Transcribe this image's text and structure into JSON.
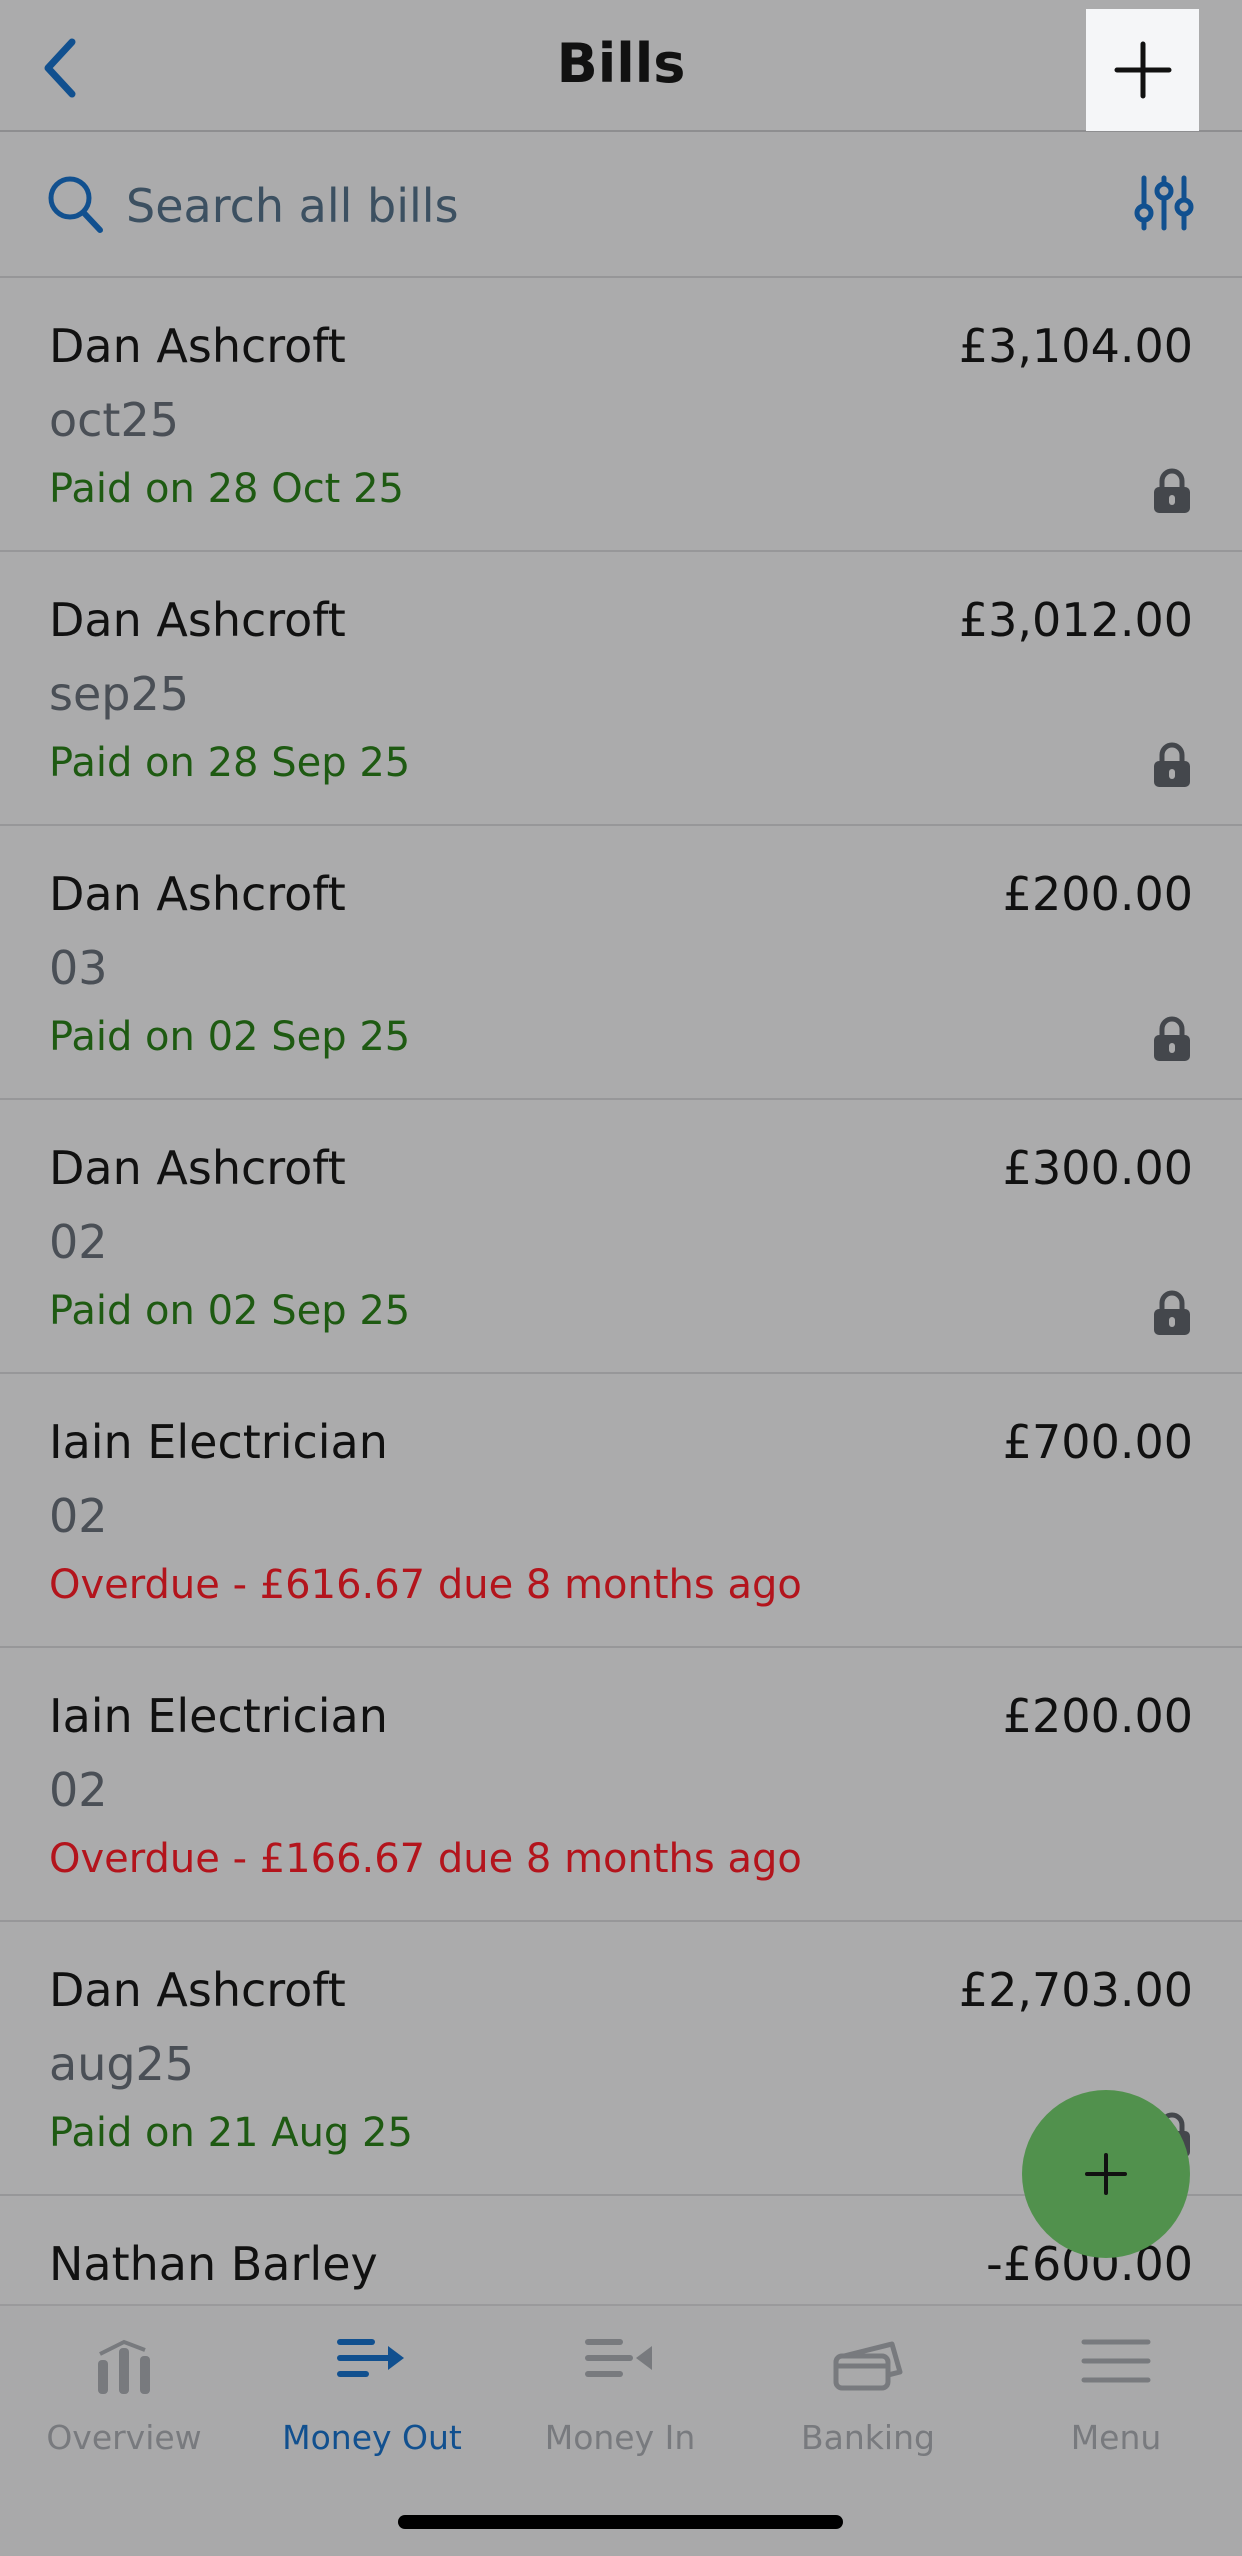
{
  "header": {
    "title": "Bills"
  },
  "search": {
    "placeholder": "Search all bills"
  },
  "colors": {
    "accent": "#11508f",
    "paid": "#1e5a12",
    "overdue": "#b3141c",
    "fab": "#51914d"
  },
  "bills": [
    {
      "name": "Dan Ashcroft",
      "amount": "£3,104.00",
      "reference": "oct25",
      "status": "Paid on 28 Oct 25",
      "status_type": "paid",
      "locked": true
    },
    {
      "name": "Dan Ashcroft",
      "amount": "£3,012.00",
      "reference": "sep25",
      "status": "Paid on 28 Sep 25",
      "status_type": "paid",
      "locked": true
    },
    {
      "name": "Dan Ashcroft",
      "amount": "£200.00",
      "reference": "03",
      "status": "Paid on 02 Sep 25",
      "status_type": "paid",
      "locked": true
    },
    {
      "name": "Dan Ashcroft",
      "amount": "£300.00",
      "reference": "02",
      "status": "Paid on 02 Sep 25",
      "status_type": "paid",
      "locked": true
    },
    {
      "name": "Iain Electrician",
      "amount": "£700.00",
      "reference": "02",
      "status": "Overdue - £616.67 due 8 months ago",
      "status_type": "overdue",
      "locked": false
    },
    {
      "name": "Iain Electrician",
      "amount": "£200.00",
      "reference": "02",
      "status": "Overdue - £166.67 due 8 months ago",
      "status_type": "overdue",
      "locked": false
    },
    {
      "name": "Dan Ashcroft",
      "amount": "£2,703.00",
      "reference": "aug25",
      "status": "Paid on 21 Aug 25",
      "status_type": "paid",
      "locked": true
    },
    {
      "name": "Nathan Barley",
      "amount": "-£600.00",
      "reference": "",
      "status": "",
      "status_type": "paid",
      "locked": false
    }
  ],
  "tabs": [
    {
      "label": "Overview",
      "icon": "overview-icon",
      "active": false
    },
    {
      "label": "Money Out",
      "icon": "money-out-icon",
      "active": true
    },
    {
      "label": "Money In",
      "icon": "money-in-icon",
      "active": false
    },
    {
      "label": "Banking",
      "icon": "banking-icon",
      "active": false
    },
    {
      "label": "Menu",
      "icon": "menu-icon",
      "active": false
    }
  ]
}
